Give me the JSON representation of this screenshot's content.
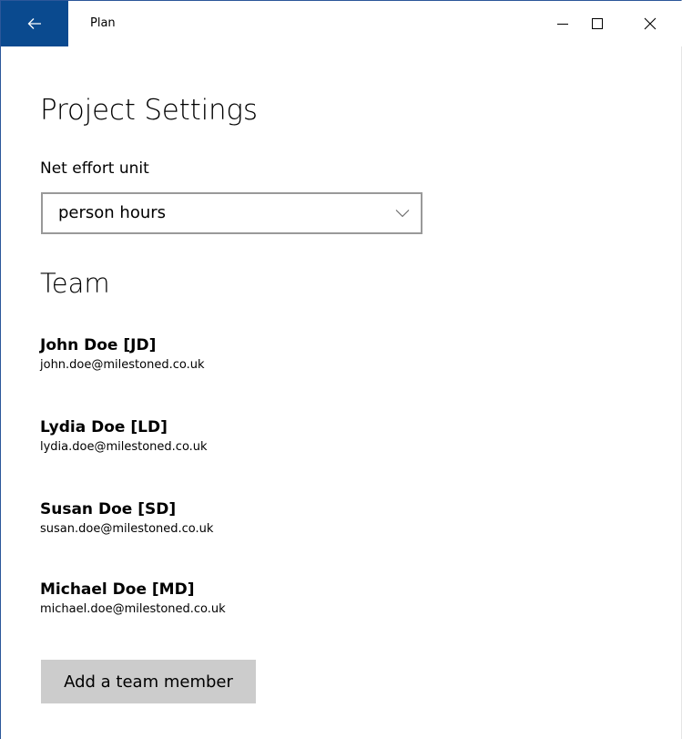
{
  "window": {
    "title": "Plan",
    "accent": "#0a4a8f"
  },
  "page": {
    "title": "Project Settings"
  },
  "effort": {
    "label": "Net effort unit",
    "selected": "person hours"
  },
  "team": {
    "title": "Team",
    "members": [
      {
        "name": "John Doe [JD]",
        "email": "john.doe@milestoned.co.uk"
      },
      {
        "name": "Lydia Doe [LD]",
        "email": "lydia.doe@milestoned.co.uk"
      },
      {
        "name": "Susan Doe [SD]",
        "email": "susan.doe@milestoned.co.uk"
      },
      {
        "name": "Michael Doe [MD]",
        "email": "michael.doe@milestoned.co.uk"
      }
    ],
    "add_button": "Add a team member"
  },
  "icons": {
    "back": "back-arrow-icon",
    "minimize": "minimize-icon",
    "maximize": "maximize-icon",
    "close": "close-icon",
    "dropdown": "chevron-down-icon"
  }
}
